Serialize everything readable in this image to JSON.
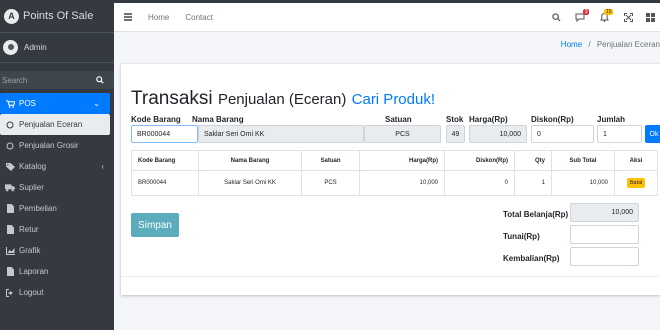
{
  "app": {
    "brand": "Points Of Sale",
    "brand_logo": "A"
  },
  "user": {
    "name": "Admin"
  },
  "sidebar": {
    "search_placeholder": "Search",
    "items": [
      {
        "label": "POS",
        "icon": "cart-icon"
      },
      {
        "label": "Penjualan Eceran",
        "icon": "circle-icon"
      },
      {
        "label": "Penjualan Grosir",
        "icon": "circle-icon"
      },
      {
        "label": "Katalog",
        "icon": "tags-icon"
      },
      {
        "label": "Suplier",
        "icon": "truck-icon"
      },
      {
        "label": "Pembelian",
        "icon": "file-icon"
      },
      {
        "label": "Retur",
        "icon": "file-icon"
      },
      {
        "label": "Grafik",
        "icon": "chart-icon"
      },
      {
        "label": "Laporan",
        "icon": "file-icon"
      },
      {
        "label": "Logout",
        "icon": "logout-icon"
      }
    ]
  },
  "topbar": {
    "links": [
      "Home",
      "Contact"
    ],
    "messages_badge": "3",
    "notifications_badge": "15",
    "badge_colors": {
      "messages": "#dc3545",
      "notifications": "#ffc107"
    }
  },
  "breadcrumb": {
    "home": "Home",
    "separator": "/",
    "current": "Penjualan Eceran"
  },
  "page": {
    "title_main": "Transaksi",
    "title_sub": "Penjualan (Eceran)",
    "title_link": "Cari Produk!"
  },
  "form": {
    "labels": {
      "kode": "Kode Barang",
      "nama": "Nama Barang",
      "satuan": "Satuan",
      "stok": "Stok",
      "harga": "Harga(Rp)",
      "diskon": "Diskon(Rp)",
      "jumlah": "Jumlah"
    },
    "values": {
      "kode": "BR000044",
      "nama": "Saklar Seri Omi KK",
      "satuan": "PCS",
      "stok": "49",
      "harga": "10,000",
      "diskon": "0",
      "jumlah": "1"
    },
    "ok_label": "Ok"
  },
  "table": {
    "headers": [
      "Kode Barang",
      "Nama Barang",
      "Satuan",
      "Harga(Rp)",
      "Diskon(Rp)",
      "Qty",
      "Sub Total",
      "Aksi"
    ],
    "rows": [
      {
        "kode": "BR000044",
        "nama": "Saklar Seri Omi KK",
        "satuan": "PCS",
        "harga": "10,000",
        "diskon": "0",
        "qty": "1",
        "subtotal": "10,000",
        "aksi": "Batal"
      }
    ]
  },
  "summary": {
    "simpan_label": "Simpan",
    "total_label": "Total Belanja(Rp)",
    "total_value": "10,000",
    "tunai_label": "Tunai(Rp)",
    "tunai_value": "",
    "kembalian_label": "Kembalian(Rp)",
    "kembalian_value": ""
  },
  "colors": {
    "primary": "#007bff",
    "sidebar": "#343a40",
    "simpan": "#5bacbc",
    "batal": "#ffc107"
  }
}
